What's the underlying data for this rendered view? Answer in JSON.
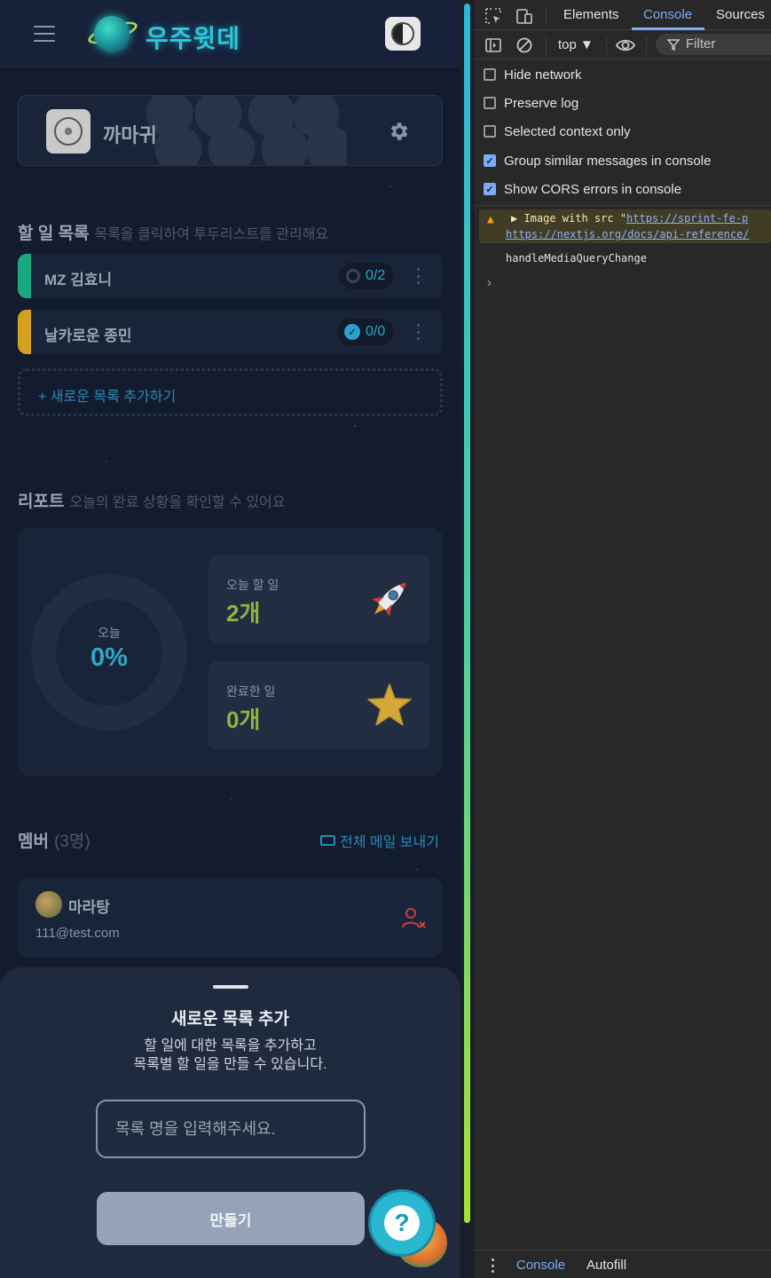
{
  "app": {
    "logo_text": "우주윗데",
    "team": {
      "name": "까마귀"
    },
    "todo_section": {
      "title": "할 일 목록",
      "subtitle": "목록을 클릭하여 투두리스트를 관리해요",
      "items": [
        {
          "label": "MZ 김효니",
          "progress": "0/2",
          "status": "in-progress",
          "color": "#1aa880"
        },
        {
          "label": "날카로운 종민",
          "progress": "0/0",
          "status": "complete",
          "color": "#d4a020"
        }
      ],
      "add_label": "+ 새로운 목록 추가하기"
    },
    "report": {
      "title": "리포트",
      "subtitle": "오늘의 완료 상황을 확인할 수 있어요",
      "donut_label": "오늘",
      "percent": "0%",
      "stats": [
        {
          "label": "오늘 할 일",
          "value": "2개",
          "icon": "rocket-icon"
        },
        {
          "label": "완료한 일",
          "value": "0개",
          "icon": "star-icon"
        }
      ]
    },
    "members": {
      "title": "멤버",
      "count": "(3명)",
      "mail_all": "전체 메일 보내기",
      "list": [
        {
          "name": "마라탕",
          "email": "111@test.com"
        }
      ]
    },
    "sheet": {
      "title": "새로운 목록 추가",
      "desc_line1": "할 일에 대한 목록을 추가하고",
      "desc_line2": "목록별 할 일을 만들 수 있습니다.",
      "input_placeholder": "목록 명을 입력해주세요.",
      "create_label": "만들기"
    },
    "help_label": "?"
  },
  "devtools": {
    "tabs": [
      "Elements",
      "Console",
      "Sources"
    ],
    "active_tab": "Console",
    "context": "top ▼",
    "filter_placeholder": "Filter",
    "settings": [
      {
        "label": "Hide network",
        "checked": false
      },
      {
        "label": "Preserve log",
        "checked": false
      },
      {
        "label": "Selected context only",
        "checked": false
      },
      {
        "label": "Group similar messages in console",
        "checked": true
      },
      {
        "label": "Show CORS errors in console",
        "checked": true
      }
    ],
    "warning": {
      "prefix": "▶ Image with src \"",
      "link1": "https://sprint-fe-p",
      "link2": "https://nextjs.org/docs/api-reference/"
    },
    "log": "handleMediaQueryChange",
    "prompt": "›",
    "drawer_tabs": [
      "Console",
      "Autofill"
    ]
  }
}
